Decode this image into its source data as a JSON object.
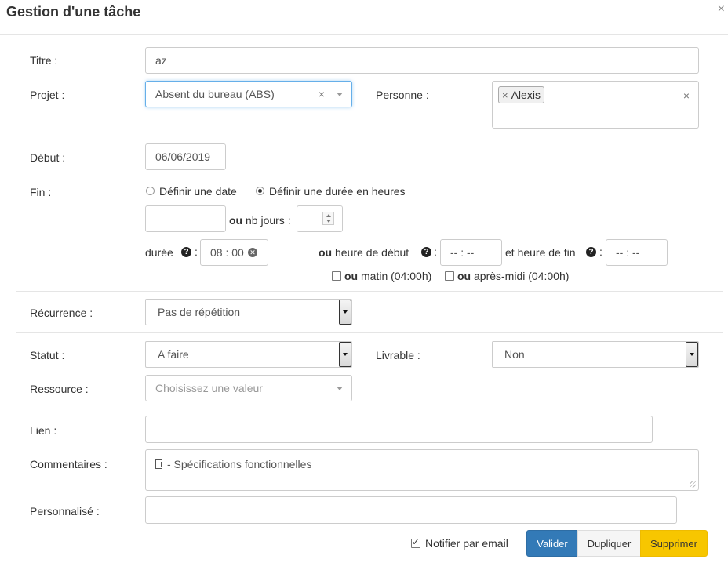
{
  "header": {
    "title": "Gestion d'une tâche",
    "close_symbol": "×"
  },
  "form": {
    "titre": {
      "label": "Titre :",
      "value": "az"
    },
    "projet": {
      "label": "Projet :",
      "value": "Absent du bureau (ABS)",
      "clear": "×"
    },
    "personne": {
      "label": "Personne :",
      "tags": [
        "Alexis"
      ],
      "tag_remove": "×",
      "clear": "×"
    },
    "debut": {
      "label": "Début :",
      "value": "06/06/2019"
    },
    "fin": {
      "label": "Fin :",
      "option_date": "Définir une date",
      "option_duree": "Définir une durée en heures",
      "selected": "duree",
      "ou": "ou",
      "nb_jours_label": "nb jours :",
      "duree_label": "durée",
      "duree_value": "08 : 00",
      "heure_debut_label": "heure de début",
      "heure_debut_value": "-- : --",
      "heure_fin_label": "et heure de fin",
      "heure_fin_value": "-- : --",
      "colon": ":",
      "matin_label": "matin (04:00h)",
      "apres_midi_label": "après-midi (04:00h)"
    },
    "recurrence": {
      "label": "Récurrence :",
      "value": "Pas de répétition"
    },
    "statut": {
      "label": "Statut :",
      "value": "A faire"
    },
    "livrable": {
      "label": "Livrable :",
      "value": "Non"
    },
    "ressource": {
      "label": "Ressource :",
      "placeholder": "Choisissez une valeur"
    },
    "lien": {
      "label": "Lien :",
      "value": ""
    },
    "commentaires": {
      "label": "Commentaires :",
      "value": "- Spécifications fonctionnelles"
    },
    "personnalise": {
      "label": "Personnalisé :",
      "value": ""
    }
  },
  "footer": {
    "notify_label": "Notifier par email",
    "notify_checked": true,
    "validate_label": "Valider",
    "duplicate_label": "Dupliquer",
    "delete_label": "Supprimer"
  },
  "colors": {
    "primary": "#337ab7",
    "warning": "#f7c600",
    "focus_border": "#66afe9"
  }
}
